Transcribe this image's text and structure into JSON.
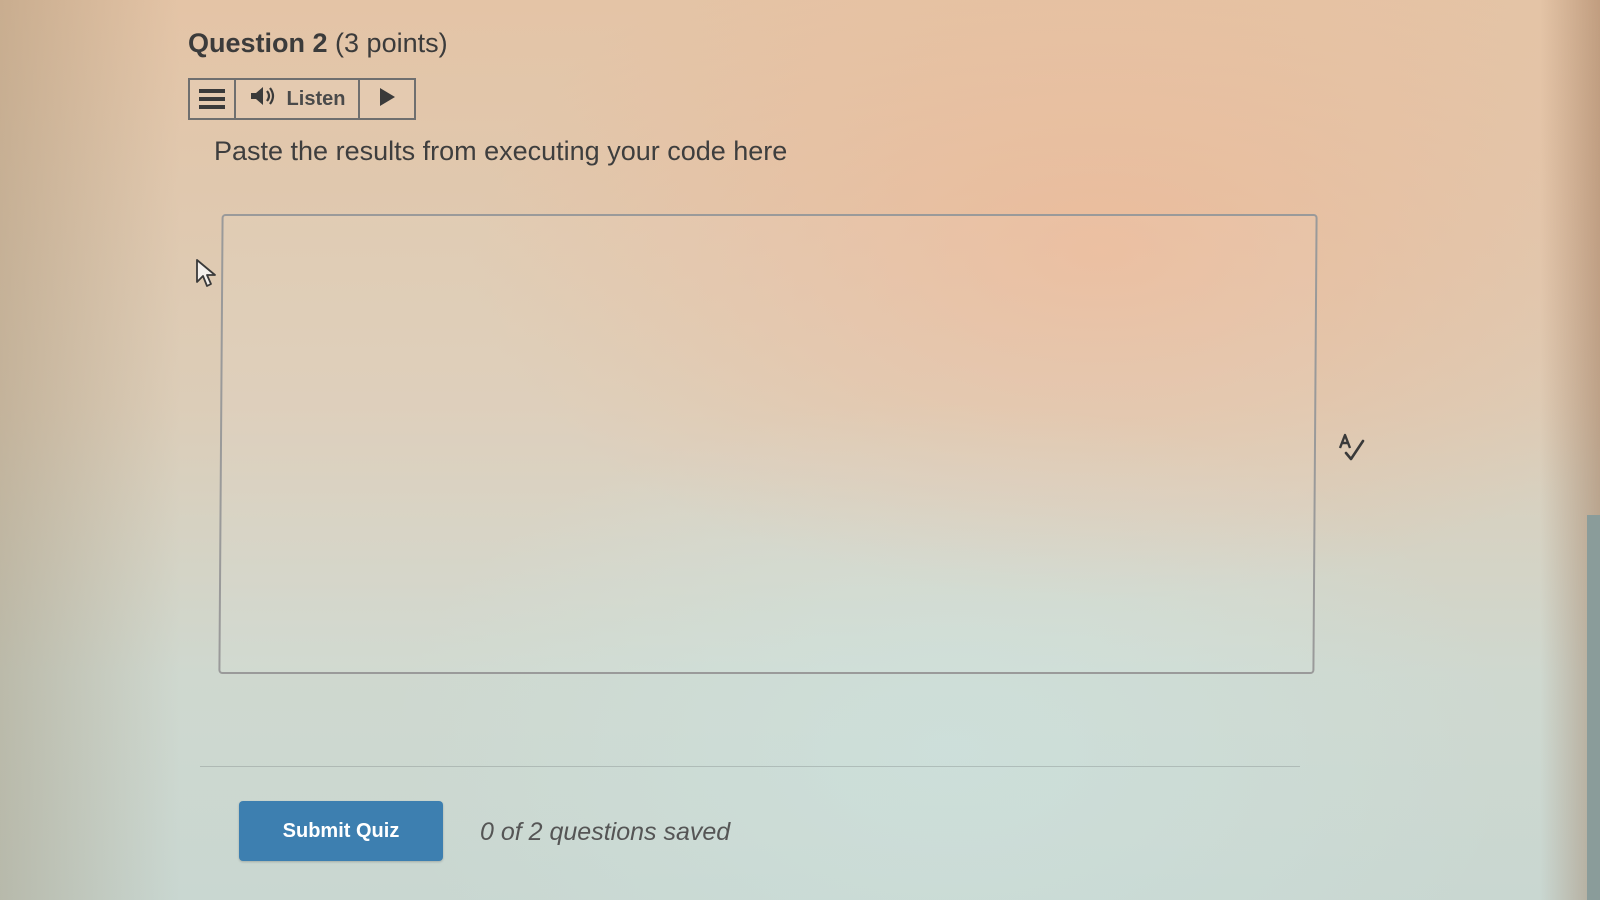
{
  "question": {
    "number_label": "Question 2",
    "points_label": "(3 points)",
    "prompt": "Paste the results from executing your code here"
  },
  "tts_toolbar": {
    "menu_icon": "hamburger-menu-icon",
    "speaker_icon": "speaker-icon",
    "listen_label": "Listen",
    "play_icon": "play-icon"
  },
  "answer": {
    "value": "",
    "spellcheck_icon": "spellcheck-icon"
  },
  "footer": {
    "submit_label": "Submit Quiz",
    "status_text": "0 of 2 questions saved"
  },
  "colors": {
    "submit_button": "#3d7fb0",
    "text": "#3b3b3b"
  }
}
